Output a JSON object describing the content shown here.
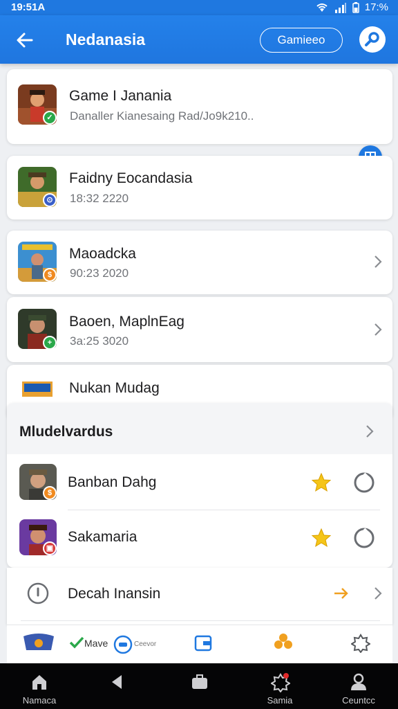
{
  "status_bar": {
    "time": "19:51A",
    "battery": "17:%"
  },
  "app_bar": {
    "title": "Nedanasia",
    "games_button": "Gamieeo"
  },
  "cards": [
    {
      "title": "Game I Janania",
      "subtitle": "Danaller Kianesaing Rad/Jo9k210.."
    },
    {
      "title": "Faidny Eocandasia",
      "subtitle": "18:32 2220"
    },
    {
      "title": "Maoadcka",
      "subtitle": "90:23 2020"
    },
    {
      "title": "Baoen, MaplnEag",
      "subtitle": "3a:25 3020"
    },
    {
      "title": "Nukan Mudag"
    }
  ],
  "section": {
    "title": "Mludelvardus",
    "rows": [
      {
        "title": "Banban Dahg"
      },
      {
        "title": "Sakamaria"
      },
      {
        "title": "Decah Inansin"
      }
    ]
  },
  "mini_toolbar": {
    "move_label": "Mave",
    "small_label": "Ceevor"
  },
  "nav": {
    "home": "Namaca",
    "profile": "Ceuntcc",
    "alerts": "Samia"
  },
  "colors": {
    "primary": "#1f78e0",
    "star": "#f5c518",
    "accent_arrow": "#f0a020"
  }
}
